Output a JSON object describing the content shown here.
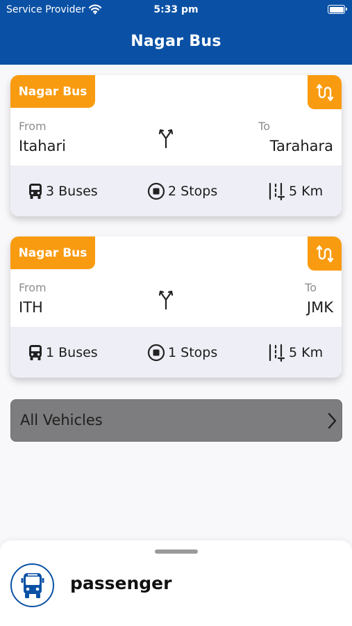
{
  "status_bar": {
    "carrier": "Service Provider",
    "time": "5:33 pm"
  },
  "header": {
    "title": "Nagar Bus"
  },
  "routes": [
    {
      "badge": "Nagar Bus",
      "from_label": "From",
      "from": "Itahari",
      "to_label": "To",
      "to": "Tarahara",
      "buses": "3 Buses",
      "stops": "2 Stops",
      "distance": "5 Km"
    },
    {
      "badge": "Nagar Bus",
      "from_label": "From",
      "from": "ITH",
      "to_label": "To",
      "to": "JMK",
      "buses": "1 Buses",
      "stops": "1 Stops",
      "distance": "5 Km"
    }
  ],
  "all_vehicles": {
    "label": "All Vehicles"
  },
  "bottom_sheet": {
    "role": "passenger"
  },
  "colors": {
    "primary": "#0a51a5",
    "accent": "#f99b10",
    "info_bg": "#eeeef6"
  },
  "icons": [
    "wifi-icon",
    "battery-icon",
    "swap-route-icon",
    "fork-icon",
    "bus-icon",
    "stop-icon",
    "distance-icon",
    "chevron-right-icon",
    "bus-avatar-icon"
  ]
}
